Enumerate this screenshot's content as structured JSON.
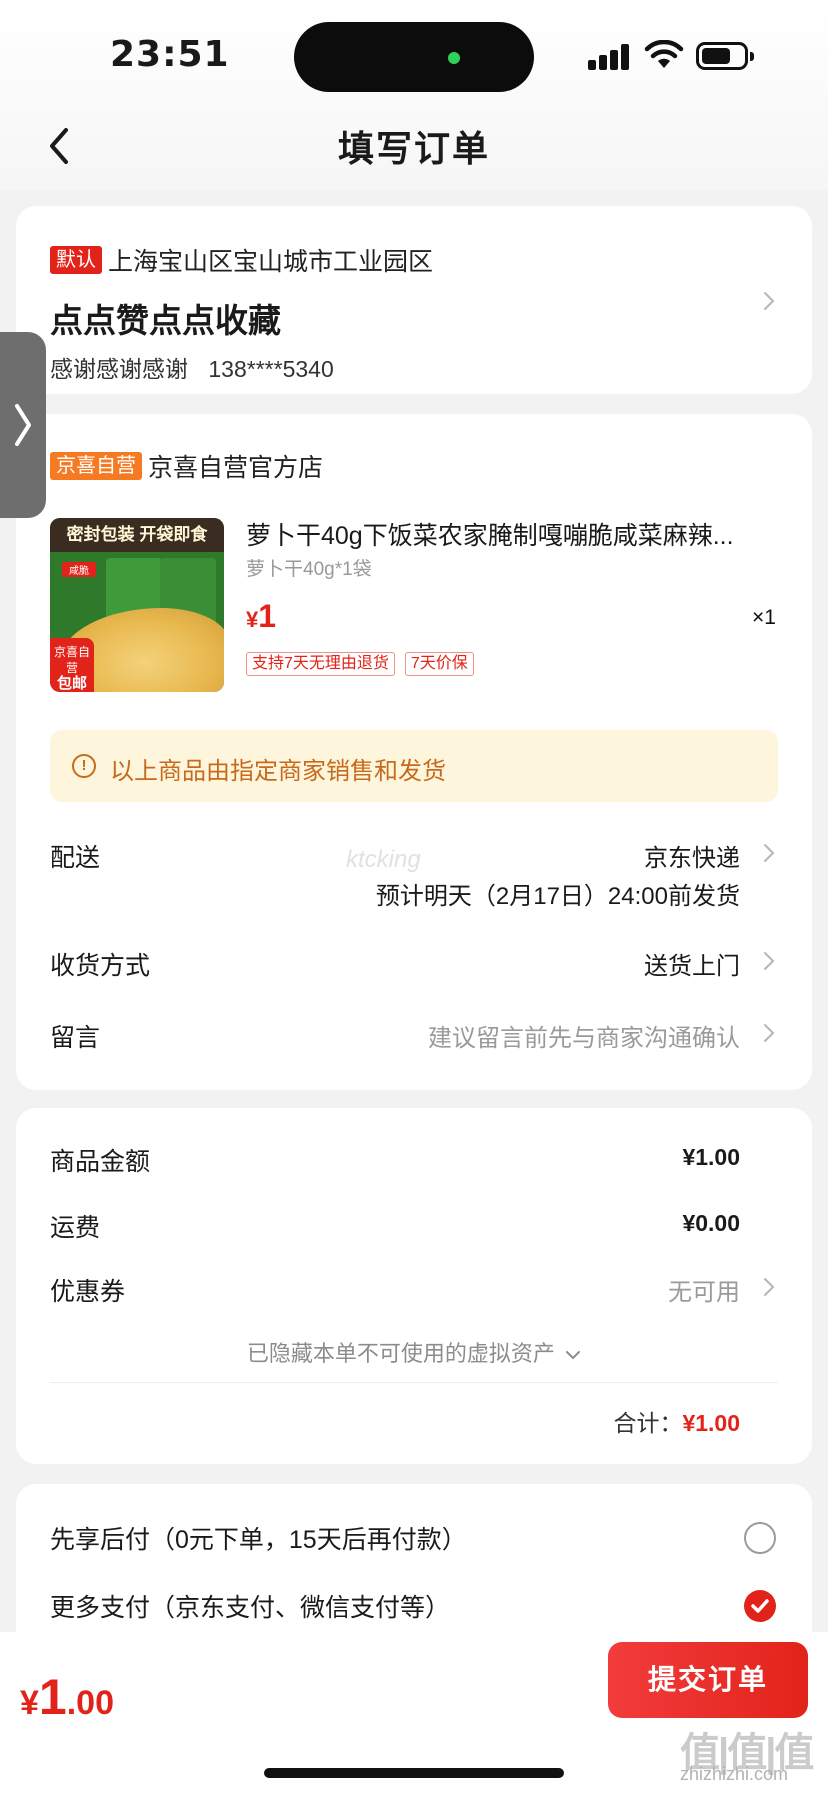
{
  "status_bar": {
    "time": "23:51"
  },
  "header": {
    "title": "填写订单"
  },
  "address": {
    "default_tag": "默认",
    "region": "上海宝山区宝山城市工业园区",
    "name": "点点赞点点收藏",
    "contact_name": "感谢感谢感谢",
    "phone": "138****5340"
  },
  "store": {
    "tag": "京喜自营",
    "name": "京喜自营官方店"
  },
  "product": {
    "image_banner": "密封包装 开袋即食",
    "image_badge_top": "京喜自营",
    "image_badge_bottom": "包邮",
    "title": "萝卜干40g下饭菜农家腌制嘎嘣脆咸菜麻辣...",
    "spec": "萝卜干40g*1袋",
    "price_symbol": "¥",
    "price": "1",
    "quantity": "×1",
    "tags": [
      "支持7天无理由退货",
      "7天价保"
    ]
  },
  "notice": {
    "icon": "info-icon",
    "text": "以上商品由指定商家销售和发货"
  },
  "delivery": {
    "label": "配送",
    "value": "京东快递",
    "eta": "预计明天（2月17日）24:00前发货"
  },
  "receive_method": {
    "label": "收货方式",
    "value": "送货上门"
  },
  "message": {
    "label": "留言",
    "placeholder": "建议留言前先与商家沟通确认"
  },
  "watermark": "ktcking",
  "price_summary": {
    "goods_label": "商品金额",
    "goods_value": "¥1.00",
    "freight_label": "运费",
    "freight_value": "¥0.00",
    "coupon_label": "优惠券",
    "coupon_value": "无可用",
    "hidden_assets": "已隐藏本单不可使用的虚拟资产",
    "total_label": "合计：",
    "total_value": "¥1.00"
  },
  "payment": {
    "option1": "先享后付（0元下单，15天后再付款）",
    "option1_selected": false,
    "option2": "更多支付（京东支付、微信支付等）",
    "option2_selected": true
  },
  "bottom_bar": {
    "price_symbol": "¥",
    "price_int": "1",
    "price_dec": ".00",
    "submit_label": "提交订单"
  },
  "site_watermark": {
    "mark": "值|值|值",
    "url": "zhizhizhi.com"
  },
  "colors": {
    "accent": "#e2231a",
    "store_tag": "#f57a22",
    "notice_bg": "#fdf6dc",
    "notice_text": "#c86a1c"
  }
}
